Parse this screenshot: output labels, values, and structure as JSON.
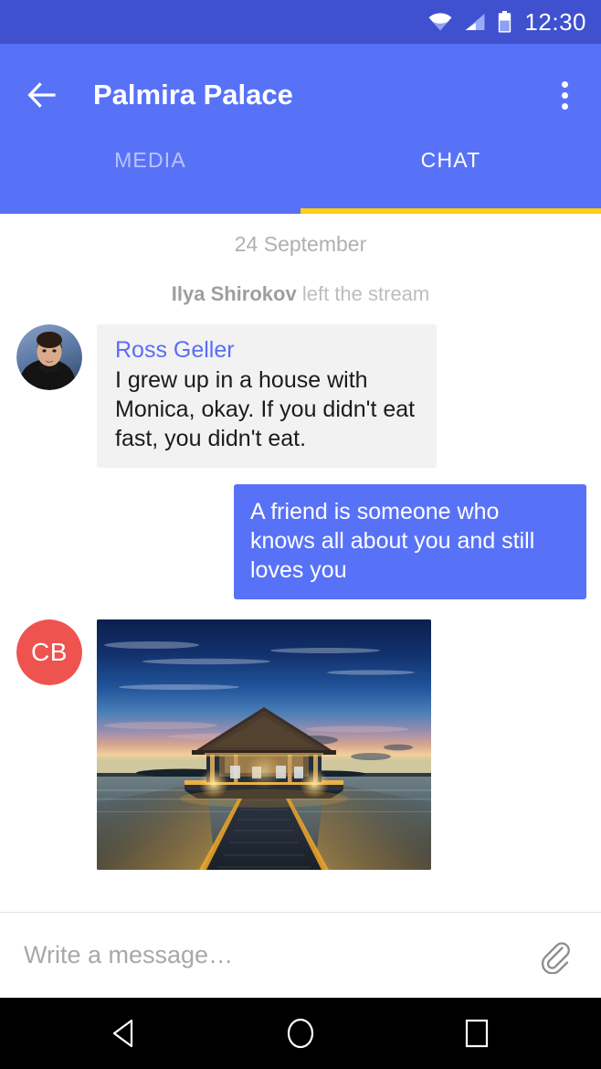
{
  "status_bar": {
    "time": "12:30",
    "icons": [
      "wifi-icon",
      "cell-signal-icon",
      "battery-icon"
    ]
  },
  "app_bar": {
    "back_icon": "arrow-left-icon",
    "title": "Palmira Palace",
    "overflow_icon": "more-vertical-icon",
    "accent_color": "#5872f7",
    "indicator_color": "#ffd014",
    "tabs": [
      {
        "label": "MEDIA",
        "active": false
      },
      {
        "label": "CHAT",
        "active": true
      }
    ]
  },
  "chat": {
    "date_separator": "24 September",
    "system_message": {
      "actor": "Ilya Shirokov",
      "text": "left the stream"
    },
    "messages": [
      {
        "type": "text",
        "direction": "incoming",
        "sender": "Ross Geller",
        "sender_color": "#5a6df5",
        "avatar_type": "photo",
        "text": "I grew up in a house with Monica, okay. If you didn't eat fast, you didn't eat."
      },
      {
        "type": "text",
        "direction": "outgoing",
        "bubble_color": "#5872f7",
        "text": "A friend is someone who knows all about you and still loves you"
      },
      {
        "type": "image",
        "direction": "incoming",
        "avatar_type": "initials",
        "avatar_initials": "CB",
        "avatar_color": "#ef5350",
        "image_description": "Tropical sunset over calm ocean with a wooden pier leading to a lit thatched-roof gazebo"
      }
    ]
  },
  "composer": {
    "placeholder": "Write a message…",
    "value": "",
    "attach_icon": "paperclip-icon"
  },
  "nav_bar": {
    "back_icon": "triangle-back-icon",
    "home_icon": "circle-home-icon",
    "recents_icon": "square-recents-icon"
  }
}
